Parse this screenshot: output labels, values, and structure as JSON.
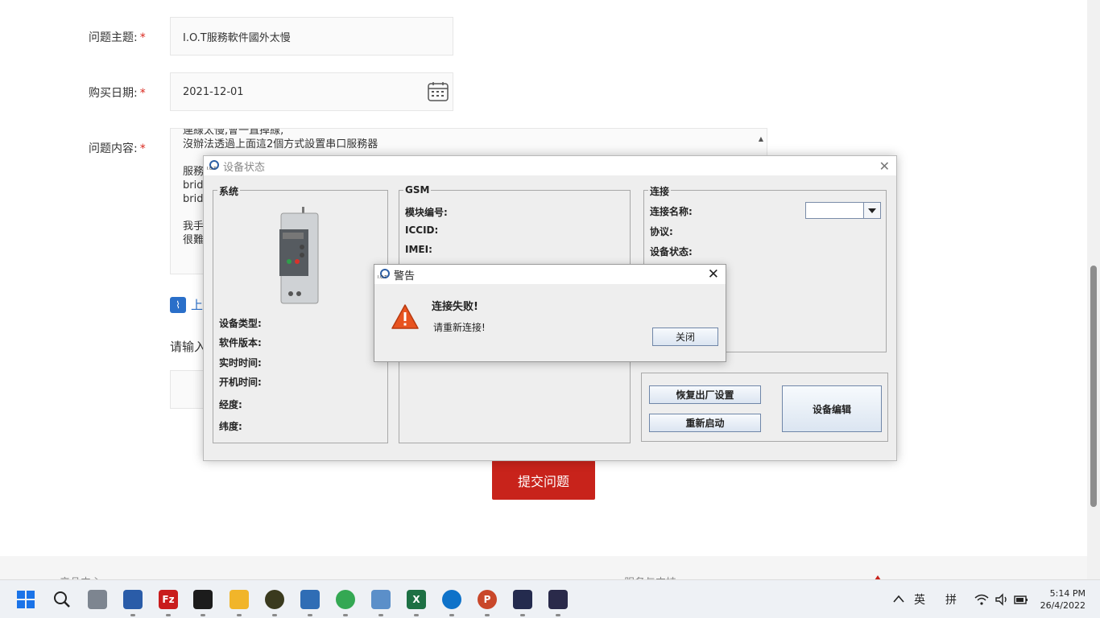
{
  "form": {
    "subject_label": "问题主题:",
    "subject_value": "I.O.T服務軟件國外太慢",
    "date_label": "购买日期:",
    "date_value": "2021-12-01",
    "content_label": "问题内容:",
    "required_mark": "*",
    "content_lines": [
      "連線太慢,會一直掉線,",
      "沒辦法透過上面這2個方式設置串口服務器",
      "",
      "服務",
      "brid",
      "brid",
      "",
      "我手",
      "很難"
    ],
    "upload_label": "上",
    "input_prompt": "请输入",
    "submit_label": "提交问题"
  },
  "footer": {
    "left_text": "产品中心",
    "right_text": "服务与支持"
  },
  "device_window": {
    "title": "设备状态",
    "system_group": "系统",
    "gsm_group": "GSM",
    "connect_group": "连接",
    "system_fields": [
      "设备类型:",
      "软件版本:",
      "实时时间:",
      "开机时间:",
      "经度:",
      "纬度:"
    ],
    "gsm_fields": [
      "模块编号:",
      "ICCID:",
      "IMEI:"
    ],
    "connect_fields": [
      "连接名称:",
      "协议:",
      "设备状态:"
    ],
    "factory_reset_button": "恢复出厂设置",
    "restart_button": "重新启动",
    "edit_button": "设备编辑",
    "icon_text": "I.O.T"
  },
  "dialog": {
    "title": "警告",
    "message_main": "连接失败!",
    "message_sub": "请重新连接!",
    "close_button": "关闭"
  },
  "taskbar": {
    "ime_lang": "英",
    "ime_mode": "拼",
    "time": "5:14 PM",
    "date": "26/4/2022"
  },
  "colors": {
    "submit": "#c8231b",
    "link": "#2a6fc9",
    "warning": "#e8531f"
  }
}
